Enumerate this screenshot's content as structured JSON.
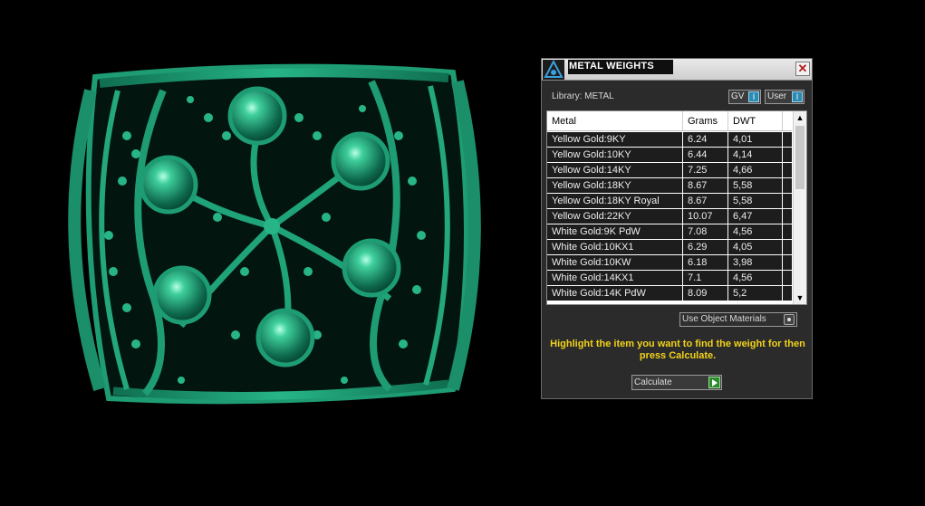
{
  "panel": {
    "title": "METAL WEIGHTS",
    "close_glyph": "✕",
    "library_label": "Library: METAL",
    "gv_label": "GV",
    "user_label": "User",
    "toggle_glyph": "I",
    "use_object_materials_label": "Use Object Materials",
    "hint_text": "Highlight the item you want to find the weight for then press Calculate.",
    "calculate_label": "Calculate",
    "accent_color": "#f2d21b"
  },
  "table": {
    "columns": [
      "Metal",
      "Grams",
      "DWT"
    ],
    "rows": [
      [
        "Yellow Gold:9KY",
        "6.24",
        "4,01"
      ],
      [
        "Yellow Gold:10KY",
        "6.44",
        "4,14"
      ],
      [
        "Yellow Gold:14KY",
        "7.25",
        "4,66"
      ],
      [
        "Yellow Gold:18KY",
        "8.67",
        "5,58"
      ],
      [
        "Yellow Gold:18KY Royal",
        "8.67",
        "5,58"
      ],
      [
        "Yellow Gold:22KY",
        "10.07",
        "6,47"
      ],
      [
        "White Gold:9K PdW",
        "7.08",
        "4,56"
      ],
      [
        "White Gold:10KX1",
        "6.29",
        "4,05"
      ],
      [
        "White Gold:10KW",
        "6.18",
        "3,98"
      ],
      [
        "White Gold:14KX1",
        "7.1",
        "4,56"
      ],
      [
        "White Gold:14K PdW",
        "8.09",
        "5,2"
      ]
    ],
    "scroll_up_glyph": "▲",
    "scroll_down_glyph": "▼"
  },
  "viewport": {
    "model_color": "#1e9c74"
  }
}
